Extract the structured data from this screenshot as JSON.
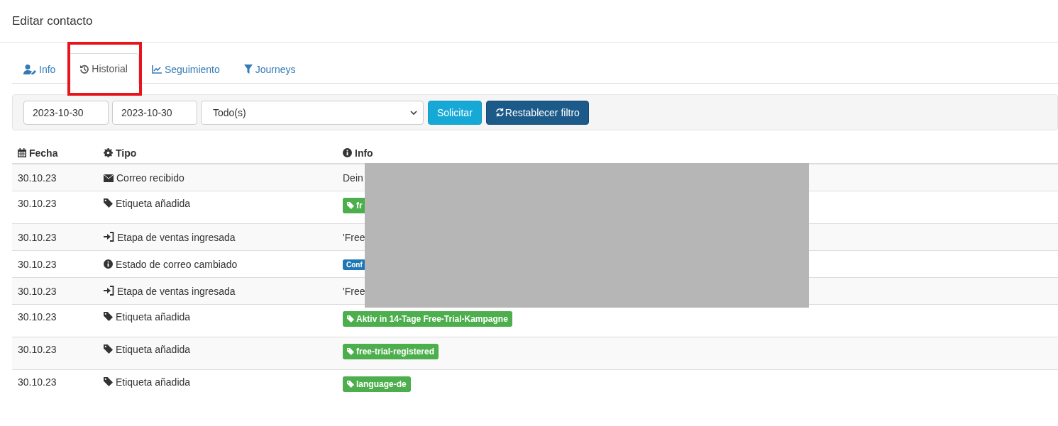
{
  "dialog": {
    "title": "Editar contacto"
  },
  "tabs": [
    {
      "label": "Info",
      "selected": false
    },
    {
      "label": "Historial",
      "selected": true
    },
    {
      "label": "Seguimiento",
      "selected": false
    },
    {
      "label": "Journeys",
      "selected": false
    }
  ],
  "filter": {
    "date_from": "2023-10-30",
    "date_to": "2023-10-30",
    "type": "Todo(s)",
    "submit": "Solicitar",
    "reset": "Restablecer filtro"
  },
  "table": {
    "columns": [
      "Fecha",
      "Tipo",
      "Info"
    ],
    "rows": [
      {
        "date": "30.10.23",
        "kind": "mail",
        "type": "Correo recibido",
        "info": {
          "kind": "text",
          "text": "Dein"
        }
      },
      {
        "date": "30.10.23",
        "kind": "tag",
        "type": "Etiqueta añadida",
        "info": {
          "kind": "tag",
          "text": "fr"
        }
      },
      {
        "date": "30.10.23",
        "kind": "enter",
        "type": "Etapa de ventas ingresada",
        "info": {
          "kind": "text",
          "text": "'Free"
        }
      },
      {
        "date": "30.10.23",
        "kind": "info",
        "type": "Estado de correo cambiado",
        "info": {
          "kind": "status",
          "text": "Conf"
        }
      },
      {
        "date": "30.10.23",
        "kind": "enter",
        "type": "Etapa de ventas ingresada",
        "info": {
          "kind": "text",
          "text": "'Free"
        }
      },
      {
        "date": "30.10.23",
        "kind": "tag",
        "type": "Etiqueta añadida",
        "info": {
          "kind": "tag",
          "text": "Aktiv in 14-Tage Free-Trial-Kampagne"
        }
      },
      {
        "date": "30.10.23",
        "kind": "tag",
        "type": "Etiqueta añadida",
        "info": {
          "kind": "tag",
          "text": "free-trial-registered"
        }
      },
      {
        "date": "30.10.23",
        "kind": "tag",
        "type": "Etiqueta añadida",
        "info": {
          "kind": "tag",
          "text": "language-de"
        }
      }
    ]
  }
}
